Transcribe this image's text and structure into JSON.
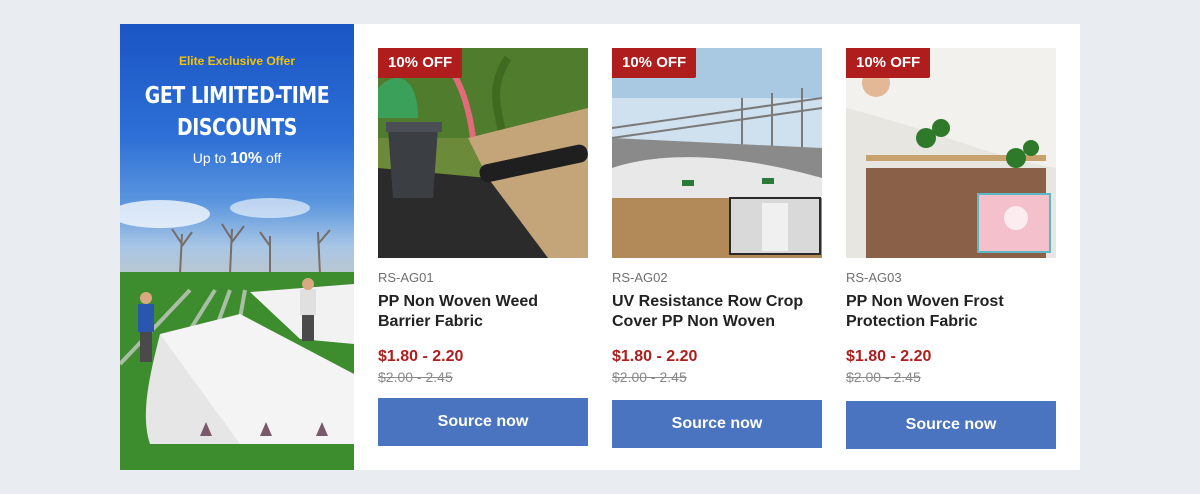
{
  "promo": {
    "kicker": "Elite Exclusive Offer",
    "headline_line1": "GET LIMITED-TIME",
    "headline_line2": "DISCOUNTS",
    "sub_prefix": "Up to",
    "sub_value": "10%",
    "sub_suffix": "off"
  },
  "products": [
    {
      "badge": "10% OFF",
      "sku": "RS-AG01",
      "name": "PP Non Woven Weed Barrier Fabric",
      "price": "$1.80 - 2.20",
      "old_price": "$2.00 - 2.45",
      "button": "Source now"
    },
    {
      "badge": "10% OFF",
      "sku": "RS-AG02",
      "name": "UV Resistance Row Crop Cover PP Non Woven",
      "price": "$1.80 - 2.20",
      "old_price": "$2.00 - 2.45",
      "button": "Source now"
    },
    {
      "badge": "10% OFF",
      "sku": "RS-AG03",
      "name": "PP Non Woven Frost Protection Fabric",
      "price": "$1.80 - 2.20",
      "old_price": "$2.00 - 2.45",
      "button": "Source now"
    }
  ],
  "colors": {
    "badge": "#b01d1d",
    "price": "#b01d1d",
    "button": "#4a74c0",
    "kicker": "#f6c300"
  }
}
